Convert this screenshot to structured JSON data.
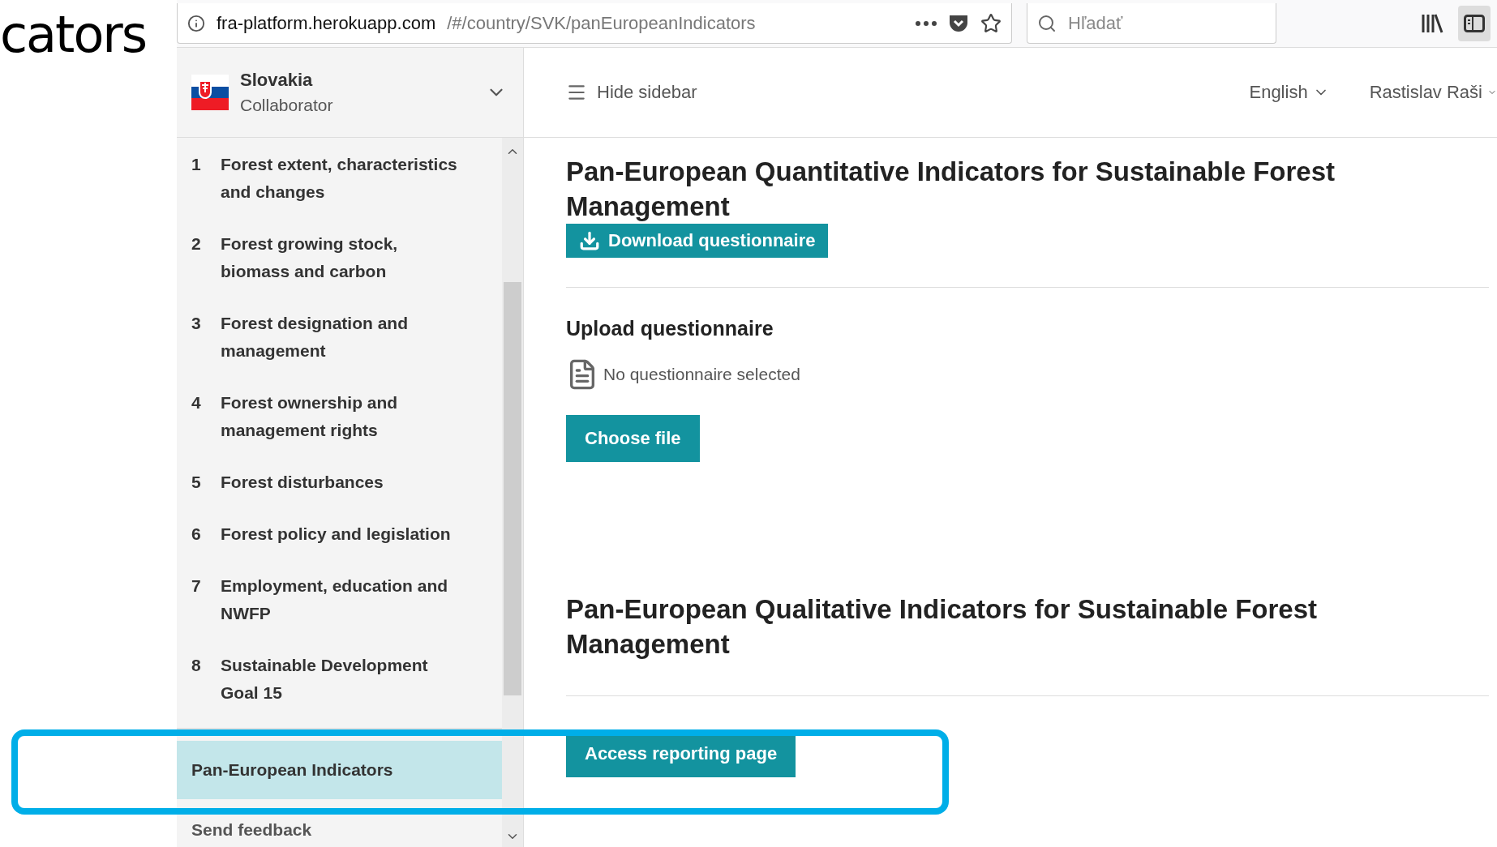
{
  "slide_text": "cators",
  "browser": {
    "url_host": "fra-platform.herokuapp.com",
    "url_path": "/#/country/SVK/panEuropeanIndicators",
    "search": {
      "placeholder": "Hľadať"
    }
  },
  "sidebar": {
    "country": "Slovakia",
    "role": "Collaborator",
    "items": [
      {
        "number": "1",
        "label": "Forest extent, characteristics and changes",
        "selected": false
      },
      {
        "number": "2",
        "label": "Forest growing stock, biomass and carbon",
        "selected": false
      },
      {
        "number": "3",
        "label": "Forest designation and management",
        "selected": false
      },
      {
        "number": "4",
        "label": "Forest ownership and management rights",
        "selected": false
      },
      {
        "number": "5",
        "label": "Forest disturbances",
        "selected": false
      },
      {
        "number": "6",
        "label": "Forest policy and legislation",
        "selected": false
      },
      {
        "number": "7",
        "label": "Employment, education and NWFP",
        "selected": false
      },
      {
        "number": "8",
        "label": "Sustainable Development Goal 15",
        "selected": false
      }
    ],
    "pan_european": {
      "label": "Pan-European Indicators",
      "selected": true
    },
    "feedback": "Send feedback"
  },
  "header": {
    "hide_sidebar": "Hide sidebar",
    "language": "English",
    "user": "Rastislav Raši"
  },
  "main": {
    "quantitative_title": "Pan-European Quantitative Indicators for Sustainable Forest Management",
    "download_button": "Download questionnaire",
    "upload_title": "Upload questionnaire",
    "upload_status": "No questionnaire selected",
    "choose_file": "Choose file",
    "qualitative_title": "Pan-European Qualitative Indicators for Sustainable Forest Management",
    "access_button": "Access reporting page"
  }
}
